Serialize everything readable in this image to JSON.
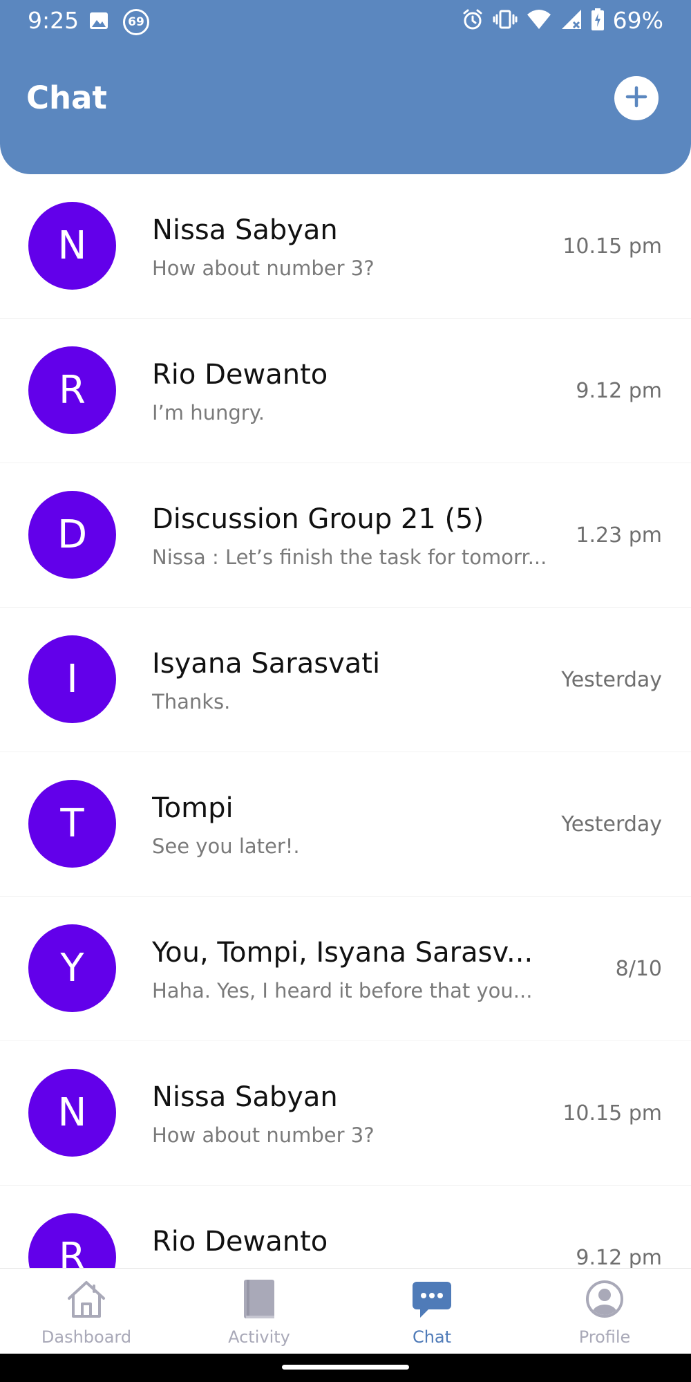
{
  "status_bar": {
    "time": "9:25",
    "notification_badge": "69",
    "battery": "69%",
    "icons_left": [
      "image-icon",
      "notification-count-icon"
    ],
    "icons_right": [
      "alarm-icon",
      "vibrate-icon",
      "wifi-icon",
      "cellular-icon",
      "battery-icon"
    ]
  },
  "header": {
    "title": "Chat",
    "add_button_icon": "plus-icon"
  },
  "colors": {
    "header": "#5b87bf",
    "avatar": "#6200ea",
    "nav_active": "#4f7bb8",
    "nav_inactive": "#a9a9b8"
  },
  "chats": [
    {
      "initial": "N",
      "name": "Nissa Sabyan",
      "preview": "How about number 3?",
      "time": "10.15 pm"
    },
    {
      "initial": "R",
      "name": "Rio Dewanto",
      "preview": "I’m hungry.",
      "time": "9.12 pm"
    },
    {
      "initial": "D",
      "name": "Discussion Group 21 (5)",
      "preview": "Nissa : Let’s finish the task for tomorr...",
      "time": "1.23 pm"
    },
    {
      "initial": "I",
      "name": "Isyana Sarasvati",
      "preview": "Thanks.",
      "time": "Yesterday"
    },
    {
      "initial": "T",
      "name": "Tompi",
      "preview": "See you later!.",
      "time": "Yesterday"
    },
    {
      "initial": "Y",
      "name": "You, Tompi, Isyana Sarasv...",
      "preview": "Haha. Yes, I heard it before that you...",
      "time": "8/10"
    },
    {
      "initial": "N",
      "name": "Nissa Sabyan",
      "preview": "How about number 3?",
      "time": "10.15 pm"
    },
    {
      "initial": "R",
      "name": "Rio Dewanto",
      "preview": "",
      "time": "9.12 pm"
    }
  ],
  "nav": {
    "items": [
      {
        "label": "Dashboard",
        "icon": "home-icon",
        "active": false
      },
      {
        "label": "Activity",
        "icon": "book-icon",
        "active": false
      },
      {
        "label": "Chat",
        "icon": "chat-bubble-icon",
        "active": true
      },
      {
        "label": "Profile",
        "icon": "profile-icon",
        "active": false
      }
    ]
  }
}
